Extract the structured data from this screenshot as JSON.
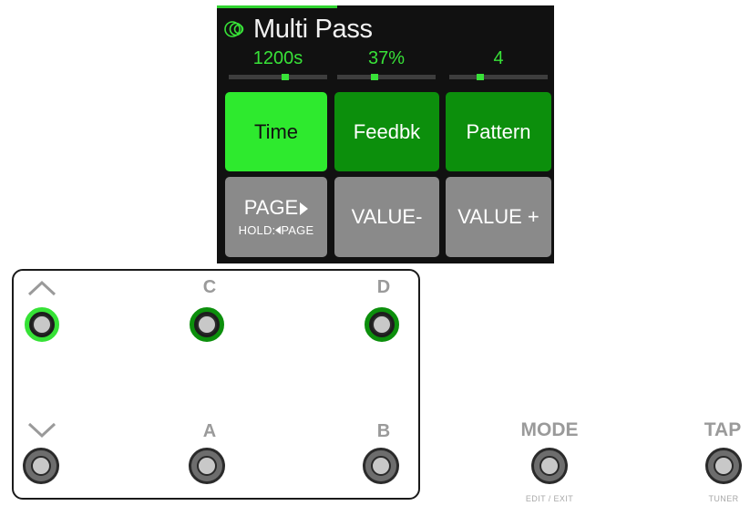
{
  "screen": {
    "title": "Multi Pass",
    "icon": "dual-circle-icon",
    "accent": "#38e238",
    "params": [
      {
        "value": "1200s",
        "level": 0.58
      },
      {
        "value": "37%",
        "level": 0.37
      },
      {
        "value": "4",
        "level": 0.3
      }
    ],
    "top_buttons": [
      {
        "label": "Time",
        "state": "selected"
      },
      {
        "label": "Feedbk",
        "state": "active"
      },
      {
        "label": "Pattern",
        "state": "active"
      }
    ],
    "bottom_buttons": {
      "page": {
        "label": "PAGE",
        "sub": "HOLD:",
        "sub_tail": "PAGE"
      },
      "value_minus": {
        "label": "VALUE-"
      },
      "value_plus": {
        "label": "VALUE +"
      }
    }
  },
  "footswitches": {
    "up_symbol": "up-chevron",
    "down_symbol": "down-chevron",
    "C": "C",
    "D": "D",
    "A": "A",
    "B": "B"
  },
  "extra": {
    "mode": {
      "label": "MODE",
      "caption": "EDIT / EXIT"
    },
    "tap": {
      "label": "TAP",
      "caption": "TUNER"
    }
  }
}
